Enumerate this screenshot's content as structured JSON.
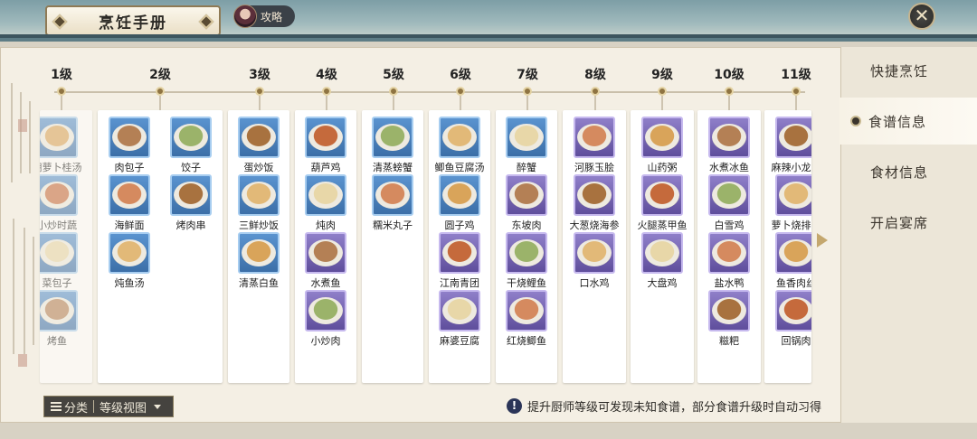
{
  "header": {
    "title": "烹饪手册",
    "guide_label": "攻略",
    "close_icon": "close-icon"
  },
  "sidebar": {
    "items": [
      {
        "label": "快捷烹饪",
        "active": false
      },
      {
        "label": "食谱信息",
        "active": true
      },
      {
        "label": "食材信息",
        "active": false
      },
      {
        "label": "开启宴席",
        "active": false
      }
    ]
  },
  "levels": [
    "1级",
    "2级",
    "3级",
    "4级",
    "5级",
    "6级",
    "7级",
    "8级",
    "9级",
    "10级",
    "11级"
  ],
  "columns": [
    {
      "level": "1级",
      "faded": true,
      "dishes": [
        {
          "name": "胡萝卜桂汤",
          "rarity": "blue"
        },
        {
          "name": "小炒时蔬",
          "rarity": "blue"
        },
        {
          "name": "菜包子",
          "rarity": "blue"
        },
        {
          "name": "烤鱼",
          "rarity": "blue"
        }
      ]
    },
    {
      "level": "2级",
      "dishes": [
        {
          "name": "肉包子",
          "rarity": "blue"
        },
        {
          "name": "饺子",
          "rarity": "blue"
        },
        {
          "name": "海鲜面",
          "rarity": "blue"
        },
        {
          "name": "烤肉串",
          "rarity": "blue"
        },
        {
          "name": "炖鱼汤",
          "rarity": "blue"
        }
      ]
    },
    {
      "level": "3级",
      "dishes": [
        {
          "name": "蛋炒饭",
          "rarity": "blue"
        },
        {
          "name": "三鲜炒饭",
          "rarity": "blue"
        },
        {
          "name": "清蒸白鱼",
          "rarity": "blue"
        }
      ]
    },
    {
      "level": "4级",
      "dishes": [
        {
          "name": "葫芦鸡",
          "rarity": "blue"
        },
        {
          "name": "炖肉",
          "rarity": "blue"
        },
        {
          "name": "水煮鱼",
          "rarity": "purple"
        },
        {
          "name": "小炒肉",
          "rarity": "purple"
        }
      ]
    },
    {
      "level": "5级",
      "dishes": [
        {
          "name": "清蒸螃蟹",
          "rarity": "blue"
        },
        {
          "name": "糯米丸子",
          "rarity": "blue"
        }
      ]
    },
    {
      "level": "6级",
      "dishes": [
        {
          "name": "鲫鱼豆腐汤",
          "rarity": "blue"
        },
        {
          "name": "圆子鸡",
          "rarity": "blue"
        },
        {
          "name": "江南青团",
          "rarity": "purple"
        },
        {
          "name": "麻婆豆腐",
          "rarity": "purple"
        }
      ]
    },
    {
      "level": "7级",
      "dishes": [
        {
          "name": "醉蟹",
          "rarity": "blue"
        },
        {
          "name": "东坡肉",
          "rarity": "purple"
        },
        {
          "name": "干烧鲤鱼",
          "rarity": "purple"
        },
        {
          "name": "红烧鲫鱼",
          "rarity": "purple"
        }
      ]
    },
    {
      "level": "8级",
      "dishes": [
        {
          "name": "河豚玉脍",
          "rarity": "purple"
        },
        {
          "name": "大葱烧海参",
          "rarity": "purple"
        },
        {
          "name": "口水鸡",
          "rarity": "purple"
        }
      ]
    },
    {
      "level": "9级",
      "dishes": [
        {
          "name": "山药粥",
          "rarity": "purple"
        },
        {
          "name": "火腿蒸甲鱼",
          "rarity": "purple"
        },
        {
          "name": "大盘鸡",
          "rarity": "purple"
        }
      ]
    },
    {
      "level": "10级",
      "dishes": [
        {
          "name": "水煮冰鱼",
          "rarity": "purple"
        },
        {
          "name": "白雪鸡",
          "rarity": "purple"
        },
        {
          "name": "盐水鸭",
          "rarity": "purple"
        },
        {
          "name": "糍粑",
          "rarity": "purple"
        }
      ]
    },
    {
      "level": "11级",
      "dishes": [
        {
          "name": "麻辣小龙虾",
          "rarity": "purple"
        },
        {
          "name": "萝卜烧排骨",
          "rarity": "purple"
        },
        {
          "name": "鱼香肉丝",
          "rarity": "purple"
        },
        {
          "name": "回锅肉",
          "rarity": "purple"
        }
      ]
    }
  ],
  "footer": {
    "category_label": "分类",
    "view_label": "等级视图",
    "hint": "提升厨师等级可发现未知食谱，部分食谱升级时自动习得",
    "hint_icon": "exclamation-icon"
  },
  "colors": {
    "blue_frame": "#4a82c0",
    "purple_frame": "#7565b5",
    "accent": "#8f7442"
  }
}
